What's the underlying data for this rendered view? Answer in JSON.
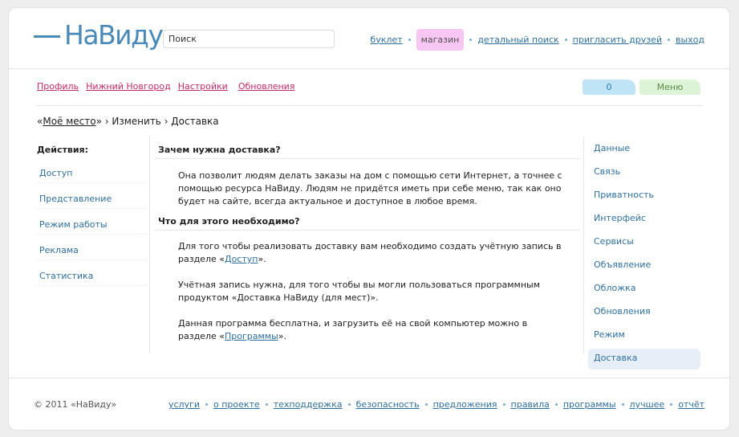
{
  "header": {
    "logo": "НаВиду",
    "search_placeholder": "Поиск",
    "nav": [
      {
        "label": "буклет",
        "highlight": false
      },
      {
        "label": "магазин",
        "highlight": true
      },
      {
        "label": "детальный поиск",
        "highlight": false
      },
      {
        "label": "пригласить друзей",
        "highlight": false
      },
      {
        "label": "выход",
        "highlight": false
      }
    ]
  },
  "subnav": [
    "Профиль",
    "Нижний Новгород",
    "Настройки",
    "Обновления"
  ],
  "counter": "0",
  "menu_label": "Меню",
  "breadcrumb": {
    "open_quote": "«",
    "place": "Моё место",
    "close_quote": "»",
    "rest": " › Изменить › Доставка"
  },
  "actions": {
    "title": "Действия:",
    "items": [
      "Доступ",
      "Представление",
      "Режим работы",
      "Реклама",
      "Статистика"
    ]
  },
  "content": {
    "h1": "Зачем нужна доставка?",
    "p1": "Она позволит людям делать заказы на дом с помощью сети Интернет, а точнее с помощью ресурса НаВиду. Людям не придётся иметь при себе меню, так как оно будет на сайте, всегда актуальное и доступное в любое время.",
    "h2": "Что для этого необходимо?",
    "p2_text": "Для того чтобы реализовать доставку вам необходимо создать учётную запись в разделе «",
    "p2_link": "Доступ",
    "p2_end": "».",
    "p3": "Учётная запись нужна, для того чтобы вы могли пользоваться программным продуктом «Доставка НаВиду (для мест)».",
    "p4_text": "Данная программа бесплатна, и загрузить её на свой компьютер можно в разделе «",
    "p4_link": "Программы",
    "p4_end": "»."
  },
  "settings_menu": [
    "Данные",
    "Связь",
    "Приватность",
    "Интерфейс",
    "Сервисы",
    "Объявление",
    "Обложка",
    "Обновления",
    "Режим",
    "Доставка"
  ],
  "settings_active": "Доставка",
  "footer": {
    "copyright": "© 2011 «НаВиду»",
    "links": [
      "услуги",
      "о проекте",
      "техподдержка",
      "безопасность",
      "предложения",
      "правила",
      "программы",
      "лучшее",
      "отчёт"
    ]
  },
  "colors": {
    "brand": "#4a8ab8",
    "link": "#2f6f9f",
    "subnav_link": "#c02a6a",
    "shop_bg": "#f7c6f2",
    "counter_bg": "#bfe4f6",
    "menu_bg": "#ddf3d6",
    "active_bg": "#e6eef8"
  }
}
